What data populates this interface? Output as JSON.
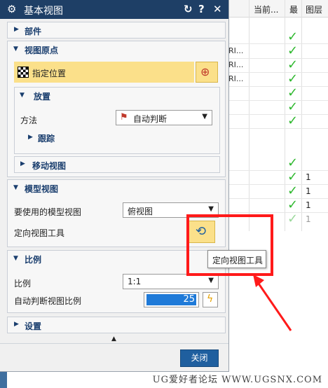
{
  "dialog": {
    "title": "基本视图",
    "reset_icon": "reset-icon",
    "help_label": "?",
    "close_icon": "close-icon",
    "sections": {
      "parts": "部件",
      "view_origin": "视图原点",
      "specify_location": "指定位置",
      "placement": "放置",
      "method_label": "方法",
      "method_value": "自动判断",
      "track": "跟踪",
      "move_view": "移动视图",
      "model_view": "模型视图",
      "model_view_to_use_label": "要使用的模型视图",
      "model_view_value": "俯视图",
      "orient_view_tool_label": "定向视图工具",
      "scale": "比例",
      "scale_label": "比例",
      "scale_value": "1:1",
      "auto_scale_label": "自动判断视图比例",
      "auto_scale_value": "25",
      "settings": "设置"
    },
    "close_button": "关闭",
    "tooltip": "定向视图工具"
  },
  "background_table": {
    "headers": [
      "当前...",
      "最",
      "图层"
    ],
    "rows": [
      {
        "name": "",
        "check": true,
        "layer": ""
      },
      {
        "name": "RI...",
        "check": true,
        "layer": ""
      },
      {
        "name": "RI...",
        "check": true,
        "layer": ""
      },
      {
        "name": "RI...",
        "check": true,
        "layer": ""
      },
      {
        "name": "",
        "check": true,
        "layer": ""
      },
      {
        "name": "",
        "check": true,
        "layer": ""
      },
      {
        "name": "",
        "check": true,
        "layer": ""
      },
      {
        "name": "",
        "check": true,
        "layer": "1"
      },
      {
        "name": "",
        "check": true,
        "layer": "1"
      },
      {
        "name": "",
        "check": true,
        "layer": "1"
      },
      {
        "name": "",
        "check": true,
        "layer": "1"
      }
    ]
  },
  "watermark": "UG爱好者论坛 WWW.UGSNX.COM",
  "colors": {
    "titlebar": "#1e3f66",
    "highlight": "#fbe08a",
    "accent_button": "#1f5f9f",
    "check_green": "#2eb82e",
    "annotation_red": "#ff1a1a"
  }
}
